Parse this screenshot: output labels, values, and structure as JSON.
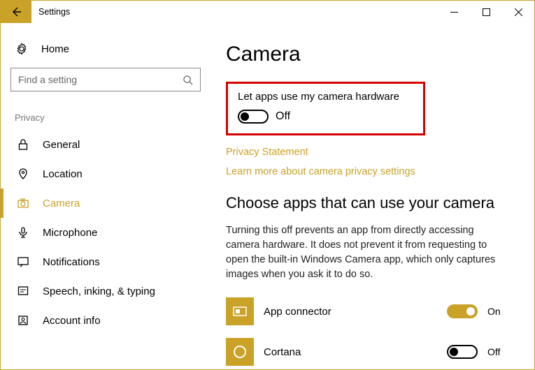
{
  "window": {
    "title": "Settings"
  },
  "left": {
    "home": "Home",
    "search_placeholder": "Find a setting",
    "section": "Privacy",
    "items": [
      {
        "label": "General"
      },
      {
        "label": "Location"
      },
      {
        "label": "Camera",
        "active": true
      },
      {
        "label": "Microphone"
      },
      {
        "label": "Notifications"
      },
      {
        "label": "Speech, inking, & typing"
      },
      {
        "label": "Account info"
      }
    ]
  },
  "main": {
    "title": "Camera",
    "toggle_label": "Let apps use my camera hardware",
    "toggle_state": "Off",
    "link1": "Privacy Statement",
    "link2": "Learn more about camera privacy settings",
    "subtitle": "Choose apps that can use your camera",
    "description": "Turning this off prevents an app from directly accessing camera hardware. It does not prevent it from requesting to open the built-in Windows Camera app, which only captures images when you ask it to do so.",
    "apps": [
      {
        "name": "App connector",
        "state": "On"
      },
      {
        "name": "Cortana",
        "state": "Off"
      }
    ]
  }
}
